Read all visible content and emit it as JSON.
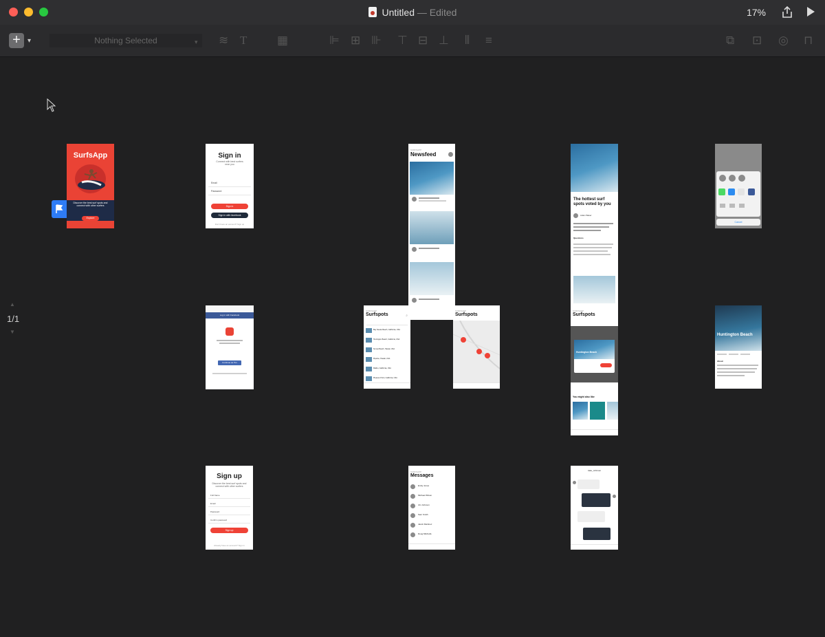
{
  "window": {
    "title": "Untitled",
    "title_suffix": "— Edited",
    "zoom": "17%",
    "traffic_colors": [
      "#fe5f57",
      "#febc2e",
      "#28c840"
    ]
  },
  "toolbar": {
    "selector_placeholder": "Nothing Selected",
    "add_icon": "+",
    "add_dropdown_icon": "▾"
  },
  "canvas": {
    "page_indicator": "1/1",
    "artboards": {
      "welcome": {
        "app_name": "SurfsApp",
        "tagline": "Discover the best surf spots and connect with other surfers",
        "button": "Explore"
      },
      "signin": {
        "title": "Sign in",
        "subtitle": "Connect with best surfers near you",
        "field_email": "Email",
        "field_password": "Password",
        "button_signin": "Sign in",
        "button_facebook": "Sign in with facebook",
        "footer": "Don't have an account? Sign up"
      },
      "newsfeed": {
        "label": "SURFSAPP",
        "title": "Newsfeed"
      },
      "article": {
        "headline": "The hottest surf spots voted by you",
        "author": "Adam Baker",
        "section": "Questions"
      },
      "share": {
        "cancel": "Cancel"
      },
      "facebook_login": {
        "top_bar": "Log in with Facebook",
        "button": "Continue as Tim"
      },
      "surfspots_list": {
        "label": "SURFSAPP",
        "title": "Surfspots",
        "items": [
          "Bay Swede Beach, California, USA",
          "Huntington Beach, California, USA",
          "Sunset Beach, Hawaii, USA",
          "Pipeline, Hawaii, USA",
          "Malibu, California, USA",
          "Pleasure Point, California, USA"
        ]
      },
      "surfspots_map": {
        "label": "SURFSAPP",
        "title": "Surfspots"
      },
      "surfspots_detail": {
        "label": "SURFSAPP",
        "title": "Surfspots",
        "spot": "Huntington Beach",
        "section": "You might also like"
      },
      "spot_page": {
        "title": "Huntington Beach",
        "section": "About"
      },
      "signup": {
        "title": "Sign up",
        "subtitle": "Discover the best surf spots and connect with other surfers",
        "field_name": "Full Name",
        "field_email": "Email",
        "field_password": "Password",
        "field_confirm": "Confirm password",
        "button": "Sign up",
        "footer": "Already have an account? Sign in"
      },
      "messages": {
        "label": "SURFSAPP",
        "title": "Messages",
        "contacts": [
          "Emily Jones",
          "Michael Wilson",
          "Jim Johnson",
          "Sam Smith",
          "Jacob Martinez",
          "Doug Mitchells"
        ]
      },
      "chat": {
        "contact": "Jake_Johnson"
      }
    }
  }
}
